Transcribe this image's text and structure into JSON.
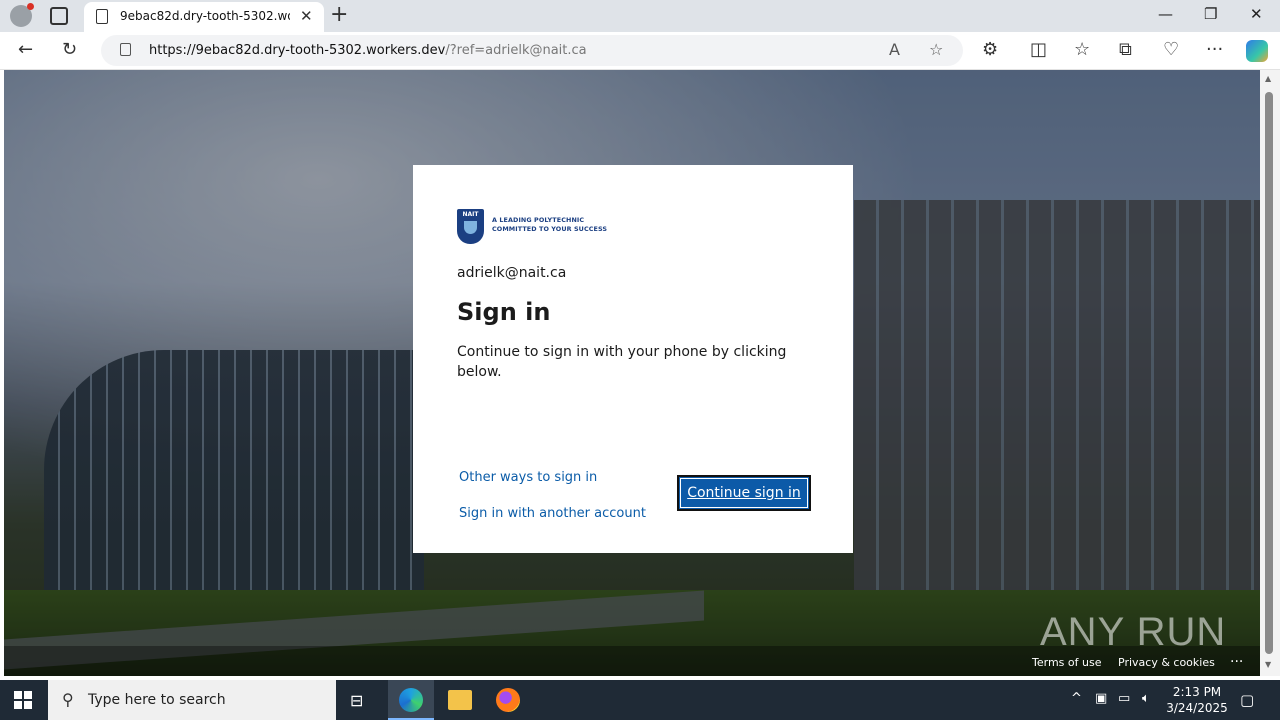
{
  "browser": {
    "tab_title": "9ebac82d.dry-tooth-5302.workers.dev",
    "url_host": "https://9ebac82d.dry-tooth-5302.workers.dev",
    "url_rest": "/?ref=adrielk@nait.ca",
    "new_tab_label": "+",
    "tab_close_label": "✕"
  },
  "signin": {
    "logo_initials": "NAIT",
    "logo_tagline_1": "A LEADING POLYTECHNIC",
    "logo_tagline_2": "COMMITTED TO YOUR SUCCESS",
    "email": "adrielk@nait.ca",
    "heading": "Sign in",
    "description": "Continue to sign in with your phone by clicking below.",
    "link_other_ways": "Other ways to sign in",
    "link_another_account": "Sign in with another account",
    "button_label": "Continue sign in"
  },
  "footer": {
    "terms": "Terms of use",
    "privacy": "Privacy & cookies",
    "more": "..."
  },
  "watermark": "ANY RUN",
  "taskbar": {
    "search_placeholder": "Type here to search",
    "time": "2:13 PM",
    "date": "3/24/2025"
  },
  "colors": {
    "link": "#0b5ca8",
    "button": "#0c5aa8",
    "taskbar": "#1f2a36"
  }
}
